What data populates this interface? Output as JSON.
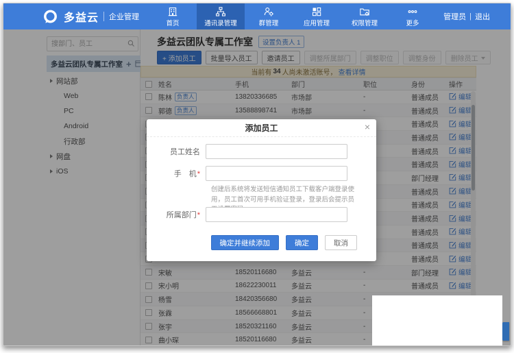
{
  "topbar": {
    "logo_text": "多益云",
    "logo_sub": "企业管理",
    "nav": [
      {
        "label": "首页",
        "active": false
      },
      {
        "label": "通讯录管理",
        "active": true
      },
      {
        "label": "群管理",
        "active": false
      },
      {
        "label": "应用管理",
        "active": false
      },
      {
        "label": "权限管理",
        "active": false
      },
      {
        "label": "更多",
        "active": false
      }
    ],
    "user": "管理员",
    "divider": "|",
    "logout": "退出"
  },
  "sidebar": {
    "search_placeholder": "搜部门、员工",
    "team_title": "多益云团队专属工作室",
    "tree": [
      {
        "label": "网站部",
        "arrow": true,
        "level": "lv1"
      },
      {
        "label": "Web",
        "arrow": false,
        "level": "lv2"
      },
      {
        "label": "PC",
        "arrow": false,
        "level": "lv2"
      },
      {
        "label": "Android",
        "arrow": false,
        "level": "lv2"
      },
      {
        "label": "行政部",
        "arrow": false,
        "level": "lv2"
      },
      {
        "label": "网盘",
        "arrow": true,
        "level": "lv1"
      },
      {
        "label": "iOS",
        "arrow": true,
        "level": "lv1"
      }
    ]
  },
  "main": {
    "title": "多益云团队专属工作室",
    "set_manager": "设置负责人 1",
    "toolbar": [
      {
        "label": "+ 添加员工",
        "style": "primary",
        "caret": false
      },
      {
        "label": "批量导入员工",
        "style": "normal",
        "caret": false
      },
      {
        "label": "邀请员工",
        "style": "normal",
        "caret": false
      },
      {
        "label": "调整所属部门",
        "style": "disabled",
        "caret": false
      },
      {
        "label": "调整职位",
        "style": "disabled",
        "caret": false
      },
      {
        "label": "调整身份",
        "style": "disabled",
        "caret": false
      },
      {
        "label": "删除员工",
        "style": "disabled",
        "caret": true
      }
    ],
    "notice": {
      "text_before": "当前有 ",
      "count": "34",
      "text_after": " 人尚未激活账号，",
      "link": "查看详情"
    },
    "table": {
      "headers": [
        "姓名",
        "手机",
        "部门",
        "职位",
        "身份",
        "操作"
      ],
      "manager_badge": "负责人",
      "edit_label": "编辑",
      "rows": [
        {
          "name": "陈林",
          "badge": true,
          "phone": "13820336685",
          "dept": "市场部",
          "pos": "-",
          "identity": "普通成员"
        },
        {
          "name": "郭德",
          "badge": true,
          "phone": "13588898741",
          "dept": "市场部",
          "pos": "-",
          "identity": "普通成员"
        },
        {
          "name": "",
          "badge": false,
          "phone": "",
          "dept": "",
          "pos": "",
          "identity": "普通成员"
        },
        {
          "name": "",
          "badge": false,
          "phone": "",
          "dept": "",
          "pos": "",
          "identity": "普通成员"
        },
        {
          "name": "",
          "badge": false,
          "phone": "",
          "dept": "",
          "pos": "",
          "identity": "普通成员"
        },
        {
          "name": "",
          "badge": false,
          "phone": "",
          "dept": "",
          "pos": "",
          "identity": "普通成员"
        },
        {
          "name": "",
          "badge": false,
          "phone": "",
          "dept": "",
          "pos": "",
          "identity": "部门经理"
        },
        {
          "name": "",
          "badge": false,
          "phone": "",
          "dept": "",
          "pos": "",
          "identity": "普通成员"
        },
        {
          "name": "",
          "badge": false,
          "phone": "",
          "dept": "",
          "pos": "",
          "identity": "普通成员"
        },
        {
          "name": "",
          "badge": false,
          "phone": "",
          "dept": "",
          "pos": "",
          "identity": "普通成员"
        },
        {
          "name": "",
          "badge": false,
          "phone": "",
          "dept": "",
          "pos": "",
          "identity": "普通成员"
        },
        {
          "name": "",
          "badge": false,
          "phone": "",
          "dept": "",
          "pos": "",
          "identity": "普通成员"
        },
        {
          "name": "",
          "badge": false,
          "phone": "",
          "dept": "",
          "pos": "",
          "identity": "普通成员"
        },
        {
          "name": "宋敏",
          "badge": false,
          "phone": "18520116680",
          "dept": "多益云",
          "pos": "-",
          "identity": "部门经理"
        },
        {
          "name": "宋小明",
          "badge": false,
          "phone": "18622230011",
          "dept": "多益云",
          "pos": "-",
          "identity": "普通成员"
        },
        {
          "name": "杨雪",
          "badge": false,
          "phone": "18420356680",
          "dept": "多益云",
          "pos": "-",
          "identity": ""
        },
        {
          "name": "张霖",
          "badge": false,
          "phone": "18566668801",
          "dept": "多益云",
          "pos": "-",
          "identity": ""
        },
        {
          "name": "张宇",
          "badge": false,
          "phone": "18520321160",
          "dept": "多益云",
          "pos": "-",
          "identity": ""
        },
        {
          "name": "曲小琛",
          "badge": false,
          "phone": "18520116680",
          "dept": "多益云",
          "pos": "-",
          "identity": ""
        }
      ]
    }
  },
  "modal": {
    "title": "添加员工",
    "close": "×",
    "fields": {
      "name_label": "员工姓名",
      "phone_label": "手　机",
      "phone_help": "创建后系统将发送短信通知员工下载客户端登录使用，员工首次可用手机验证登录，登录后会提示员工设置密码",
      "dept_label": "所属部门"
    },
    "buttons": {
      "confirm_continue": "确定并继续添加",
      "confirm": "确定",
      "cancel": "取消"
    }
  },
  "colors": {
    "accent": "#3e7dd9",
    "nav_active": "#2c62b2",
    "link": "#4a83d4",
    "notice_bg": "#faf3dc"
  }
}
